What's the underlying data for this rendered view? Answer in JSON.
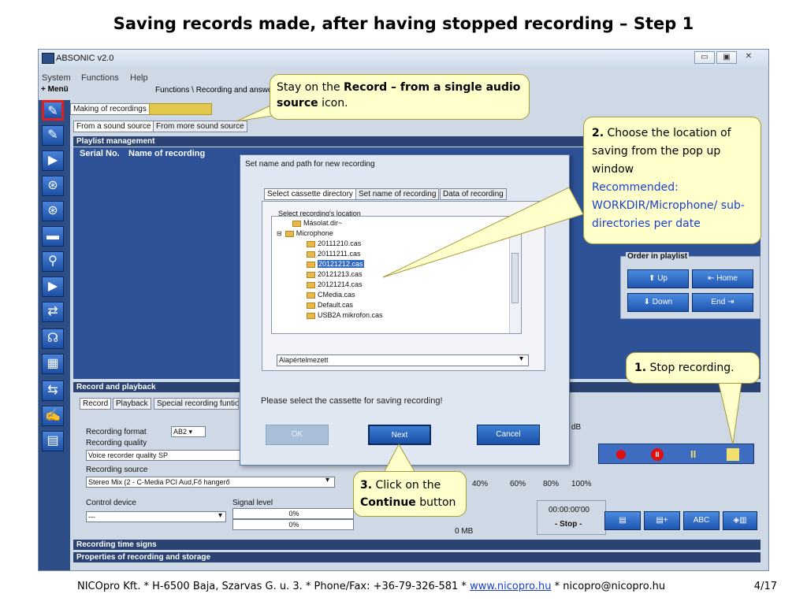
{
  "slide": {
    "title": "Saving records made, after having stopped recording – Step 1",
    "footer_text": "NICOpro Kft. * H-6500 Baja, Szarvas G. u. 3. * Phone/Fax: +36-79-326-581 * ",
    "footer_link": "www.nicopro.hu",
    "footer_email": " * nicopro@nicopro.hu",
    "page_number": "4/17"
  },
  "window": {
    "title": "ABSONIC v2.0",
    "menu": [
      "System",
      "Functions",
      "Help"
    ],
    "menu_toggle": "+ Menü",
    "breadcrumb": "Functions \\ Recording and answering"
  },
  "tabs_top": [
    "Making of recordings"
  ],
  "tabs_source": [
    "From a sound source",
    "From more sound source"
  ],
  "playlist": {
    "header": "Playlist management",
    "col_serial": "Serial No.",
    "col_name": "Name of recording",
    "order_label": "Order in playlist",
    "btn_up": "Up",
    "btn_home": "Home",
    "btn_down": "Down",
    "btn_end": "End"
  },
  "record_playback": {
    "header": "Record and playback",
    "tabs": [
      "Record",
      "Playback",
      "Special recording funtio"
    ],
    "format_label": "Recording format",
    "format_value": "AB2",
    "quality_label": "Recording quality",
    "quality_value": "Voice recorder quality SP",
    "source_label": "Recording source",
    "source_value": "Stereo Mix (2 - C-Media PCI Aud,Fő hangerő",
    "control_label": "Control device",
    "control_value": "---",
    "signal_label": "Signal level",
    "signal_1": "0%",
    "signal_2": "0%",
    "size_value": "0 MB",
    "time_value": "00:00:00'00",
    "status_value": "- Stop -",
    "db_label": "dB",
    "scale": [
      "40%",
      "60%",
      "80%",
      "100%"
    ],
    "abc_label": "ABC"
  },
  "bottom_bars": [
    "Recording time signs",
    "Properties of recording and storage"
  ],
  "dialog": {
    "title": "Set name and path for new recording",
    "tabs": [
      "Select cassette directory",
      "Set name of recording",
      "Data of recording"
    ],
    "group_label": "Select recording's location",
    "tree": [
      "Másolat.dir~",
      "Microphone",
      "20111210.cas",
      "20111211.cas",
      "20121212.cas",
      "20121213.cas",
      "20121214.cas",
      "CMedia.cas",
      "Default.cas",
      "USB2A mikrofon.cas"
    ],
    "dropdown_value": "Alapértelmezett",
    "message": "Please select the cassette for saving recording!",
    "ok": "OK",
    "next": "Next",
    "cancel": "Cancel"
  },
  "callouts": {
    "c1_pre": "Stay on the ",
    "c1_bold": "Record – from a single audio source",
    "c1_post": " icon.",
    "c2_num": "2.",
    "c2_text": " Choose the location of saving from the pop up window",
    "c2_blue": "Recommended: WORKDIR/Microphone/ sub-directories per date",
    "c3_num": "1.",
    "c3_text": " Stop recording.",
    "c4_num": "3.",
    "c4_text": " Click on the ",
    "c4_bold": "Continue",
    "c4_post": " button"
  },
  "colors": {
    "panel_header": "#2a4372",
    "playlist_bg": "#2d5298",
    "callout_bg": "#ffffcc",
    "record_red": "#e01010",
    "pause_yellow": "#f0e070"
  }
}
